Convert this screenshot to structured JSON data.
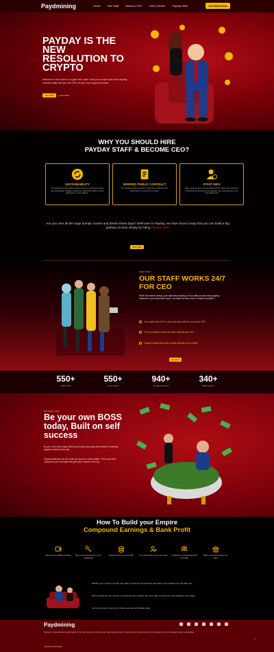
{
  "colors": {
    "gold": "#f5b800",
    "deep_red": "#7a0008",
    "black": "#050000"
  },
  "nav": {
    "logo": "Paydmining",
    "links": [
      "Home",
      "Hire Staff",
      "Become CEO",
      "How it Works",
      "Payday Mine"
    ],
    "cta": "Get Started Now"
  },
  "hero": {
    "title": "PAYDAY IS THE NEW RESOLUTION TO CRYPTO",
    "text": "Welcome to the future of crypto! Hire staff, build your empire and earn payday rewards daily. Become the CEO of your own crypto business.",
    "btn_primary": "Hire Staff",
    "btn_secondary": "Learn More"
  },
  "why": {
    "title_line1": "WHY YOU SHOULD HIRE",
    "title_line2": "PAYDAY STAFF & BECOME CEO?",
    "cards": [
      {
        "icon": "recycle-icon",
        "title": "SUSTAINABILITY",
        "text": "Our staff works around the clock to keep your earnings steady and sustainable. Payday rewards are distributed fairly to every staff owner on the platform."
      },
      {
        "icon": "contract-icon",
        "title": "VERIFIED PUBLIC CONTRACT",
        "text": "The Payday smart contract is public and verified on the blockchain for everyone to review."
      },
      {
        "icon": "staff-info-icon",
        "title": "STAFF INFO",
        "text": "Every staff member you hire works 24/7 to grow your earnings. Track their performance and upgrade your team anytime from your dashboard."
      }
    ],
    "text_before": "Are you over all the huge trumps, scams and losses these days? Well over to Payday, we have found a way that you can build a big passive income simply by hiring ",
    "text_link": "Payday staff.",
    "btn": "Hire Staff"
  },
  "staff": {
    "kicker": "HIRE STAFF",
    "title": "OUR STAFF WORKS 24/7 FOR CEO",
    "text": "While the market sleeps, your staff keep working. Every staff you hire earns payday rewards for you around the clock, no matter the time zone or market condition.",
    "bullets": [
      "Your staff works 24/7 to make the best profit for you as the CEO",
      "The more staff you hire, the more rewards you earn",
      "Payday rewards are paid out daily directly to your wallet"
    ],
    "btn": "Hire Now"
  },
  "stats": [
    {
      "value": "550+",
      "label": "Staff Hired"
    },
    {
      "value": "550+",
      "label": "Active CEOs"
    },
    {
      "value": "940+",
      "label": "Payday Rewards"
    },
    {
      "value": "340+",
      "label": "Daily Payouts"
    }
  ],
  "boss": {
    "kicker": "BECOME A CEO",
    "title": "Be your own BOSS today, Built on self success",
    "text1": "Be your own boss today. Build your empire and enjoy the freedom of earning payday rewards every day.",
    "text2": "Payday staff work for you while you focus on what matters. Hire more staff, compound your earnings and grow your empire to the top."
  },
  "empire": {
    "title_line1": "How To Build your Empire",
    "title_line2": "Compound Earnings & Bank Profit",
    "steps": [
      {
        "icon": "wallet-icon",
        "text": "Connect your wallet to Payday"
      },
      {
        "icon": "key-icon",
        "text": "Sign up and get access to your dashboard"
      },
      {
        "icon": "coins-icon",
        "text": "Deposit to hire your first staff"
      },
      {
        "icon": "user-add-icon",
        "text": "Hire more staff to grow your team"
      },
      {
        "icon": "team-icon",
        "text": "Compound your earnings with new staff"
      },
      {
        "icon": "bank-icon",
        "text": "Bank your profit anytime you want"
      }
    ],
    "paragraphs": [
      "Building your empire is simple. Hire staff, compound your earnings and watch your rewards grow day after day.",
      "Every payday you can choose to compound your rewards into more staff or bank your profit straight to your wallet.",
      "Join the growing community of CEOs earning with Payday today."
    ]
  },
  "footer": {
    "logo": "Paydmining",
    "text": "Payday is a decentralized rewards platform. Hire staff, become a CEO and earn daily payday rewards. Cryptocurrency investments carry risk, please do your own research before participating.",
    "copy": "Copyright 2023 Payday"
  }
}
